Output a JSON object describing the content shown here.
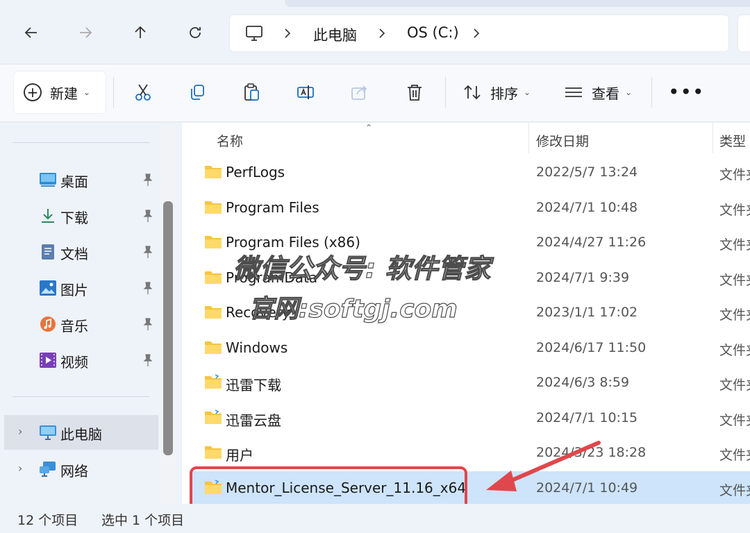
{
  "address": {
    "breadcrumbs": [
      "此电脑",
      "OS (C:)"
    ]
  },
  "toolbar": {
    "new_label": "新建",
    "sort_label": "排序",
    "view_label": "查看",
    "more": "•••"
  },
  "nav": {
    "quick_access": [
      {
        "label": "桌面",
        "icon": "desktop-icon"
      },
      {
        "label": "下载",
        "icon": "download-icon"
      },
      {
        "label": "文档",
        "icon": "documents-icon"
      },
      {
        "label": "图片",
        "icon": "pictures-icon"
      },
      {
        "label": "音乐",
        "icon": "music-icon"
      },
      {
        "label": "视频",
        "icon": "videos-icon"
      }
    ],
    "this_pc": "此电脑",
    "network": "网络"
  },
  "columns": {
    "name": "名称",
    "date": "修改日期",
    "type": "类型"
  },
  "files": [
    {
      "name": "PerfLogs",
      "date": "2022/5/7 13:24",
      "type": "文件夹"
    },
    {
      "name": "Program Files",
      "date": "2024/7/1 10:48",
      "type": "文件夹"
    },
    {
      "name": "Program Files (x86)",
      "date": "2024/4/27 11:26",
      "type": "文件夹"
    },
    {
      "name": "ProgramData",
      "date": "2024/7/1 9:39",
      "type": "文件夹"
    },
    {
      "name": "Recovery",
      "date": "2023/1/1 17:02",
      "type": "文件夹"
    },
    {
      "name": "Windows",
      "date": "2024/6/17 11:50",
      "type": "文件夹"
    },
    {
      "name": "迅雷下载",
      "date": "2024/6/3 8:59",
      "type": "文件夹"
    },
    {
      "name": "迅雷云盘",
      "date": "2024/7/1 10:15",
      "type": "文件夹"
    },
    {
      "name": "用户",
      "date": "2024/3/23 18:28",
      "type": "文件夹"
    },
    {
      "name": "Mentor_License_Server_11.16_x64",
      "date": "2024/7/1 10:49",
      "type": "文件夹"
    }
  ],
  "status": {
    "count": "12 个项目",
    "selected": "选中 1 个项目"
  },
  "watermark": {
    "line1": "微信公众号: 软件管家",
    "line2": "官网:softgj.com"
  },
  "colors": {
    "selection": "#cde4fb",
    "annotation": "#e0474c",
    "folder": "#f5c542"
  }
}
